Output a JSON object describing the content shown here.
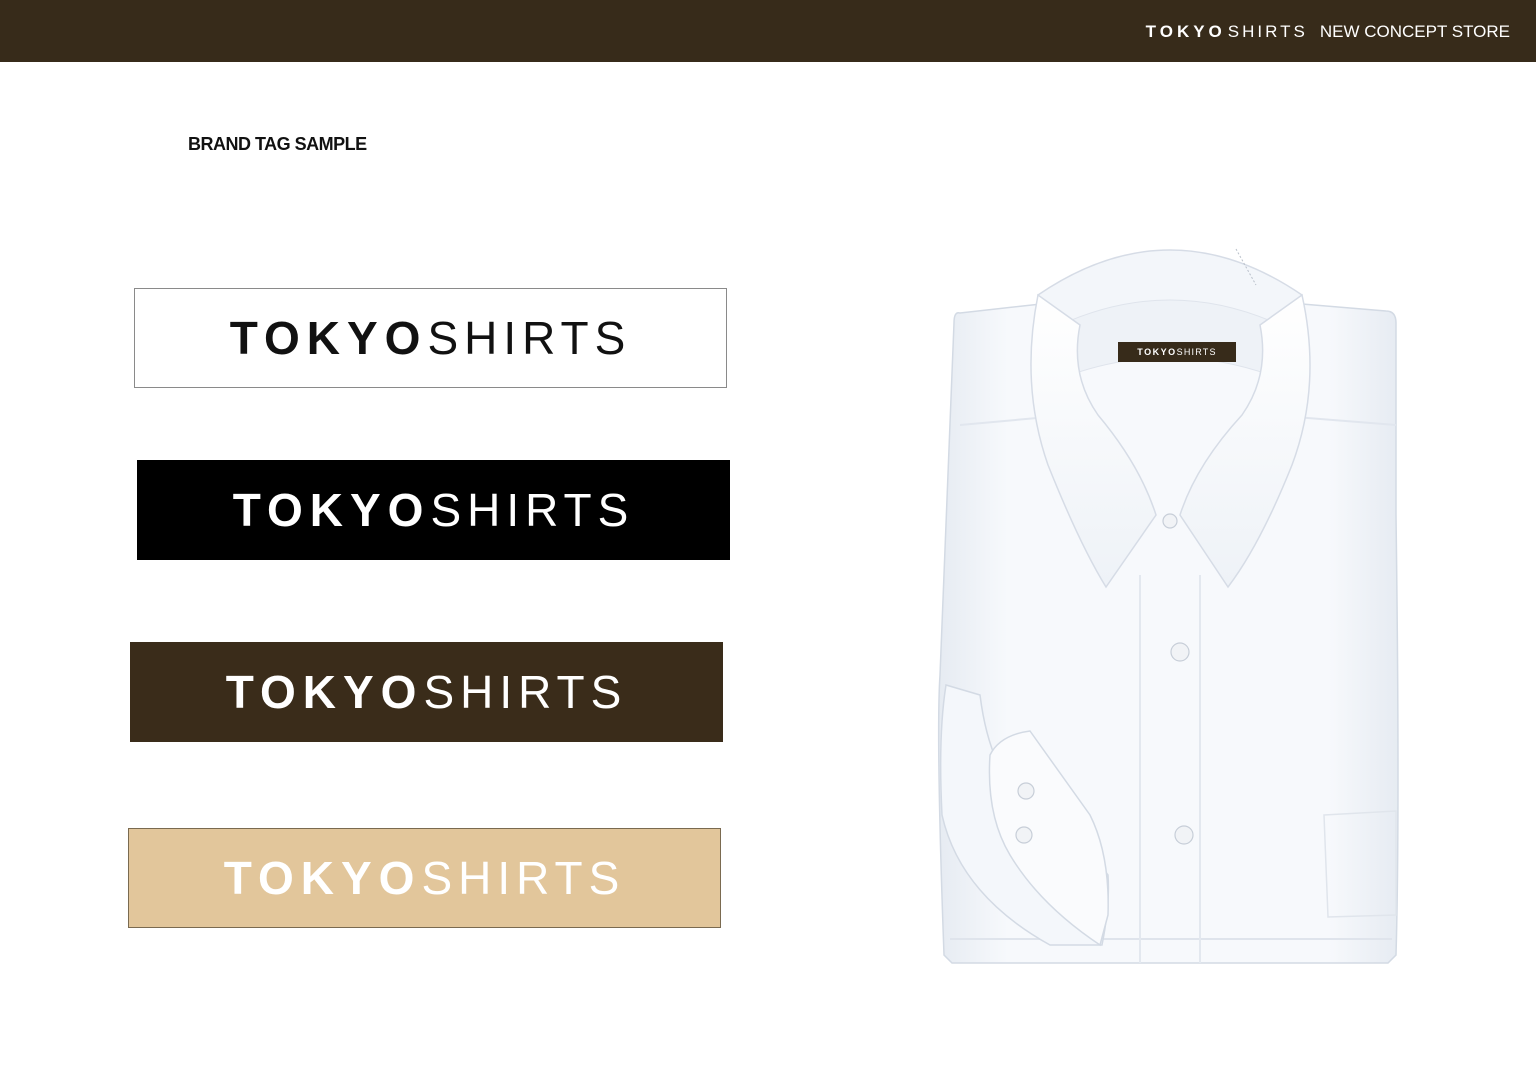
{
  "header": {
    "brand_bold": "TOKYO",
    "brand_light": "SHIRTS",
    "tagline": "NEW CONCEPT STORE"
  },
  "section_title": "BRAND TAG SAMPLE",
  "tags": [
    {
      "bold": "TOKYO",
      "light": "SHIRTS",
      "background": "#ffffff",
      "text_color": "#111111"
    },
    {
      "bold": "TOKYO",
      "light": "SHIRTS",
      "background": "#000000",
      "text_color": "#ffffff"
    },
    {
      "bold": "TOKYO",
      "light": "SHIRTS",
      "background": "#3a2c1a",
      "text_color": "#ffffff"
    },
    {
      "bold": "TOKYO",
      "light": "SHIRTS",
      "background": "#e2c69b",
      "text_color": "#ffffff"
    }
  ],
  "shirt": {
    "label_bold": "TOKYO",
    "label_light": "SHIRTS",
    "icon": "folded-dress-shirt"
  },
  "colors": {
    "brand_dark_brown": "#372b1a",
    "beige": "#e2c69b"
  }
}
